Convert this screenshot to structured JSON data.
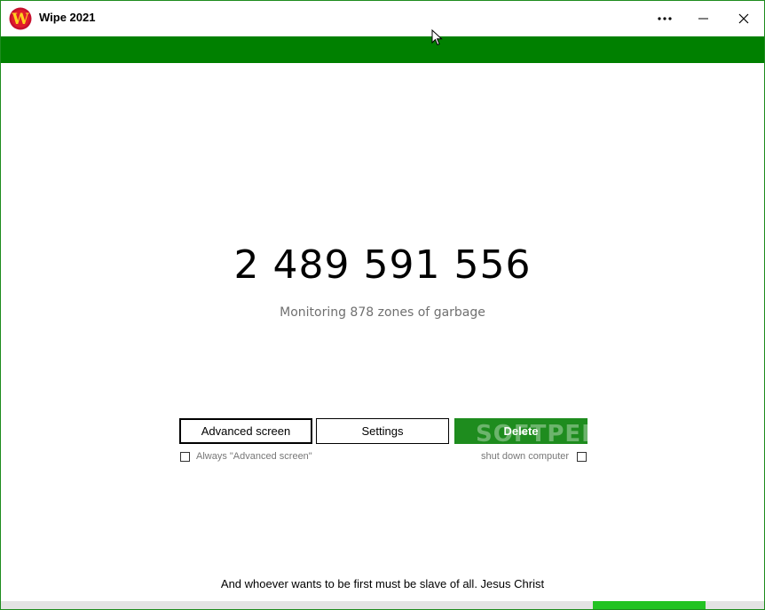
{
  "window": {
    "title": "Wipe 2021",
    "logo_letter": "W",
    "controls": [
      "more-options",
      "minimize",
      "close"
    ]
  },
  "colors": {
    "accent": "#008000",
    "delete_button": "#1e8c1e",
    "progress_fill": "#22c322",
    "subtitle": "#707070"
  },
  "main": {
    "counter": "2 489 591 556",
    "subtitle": "Monitoring 878 zones of garbage"
  },
  "buttons": {
    "advanced": "Advanced screen",
    "settings": "Settings",
    "delete": "Delete"
  },
  "options": {
    "always_advanced": {
      "label": "Always \"Advanced screen\"",
      "checked": false
    },
    "shutdown": {
      "label": "shut down computer",
      "checked": false
    }
  },
  "watermark": "SOFTPEDIA",
  "footer": {
    "quote": "And whoever wants to be first must be slave of all. Jesus Christ"
  },
  "progress": {
    "start": 0.775,
    "end": 0.923
  }
}
